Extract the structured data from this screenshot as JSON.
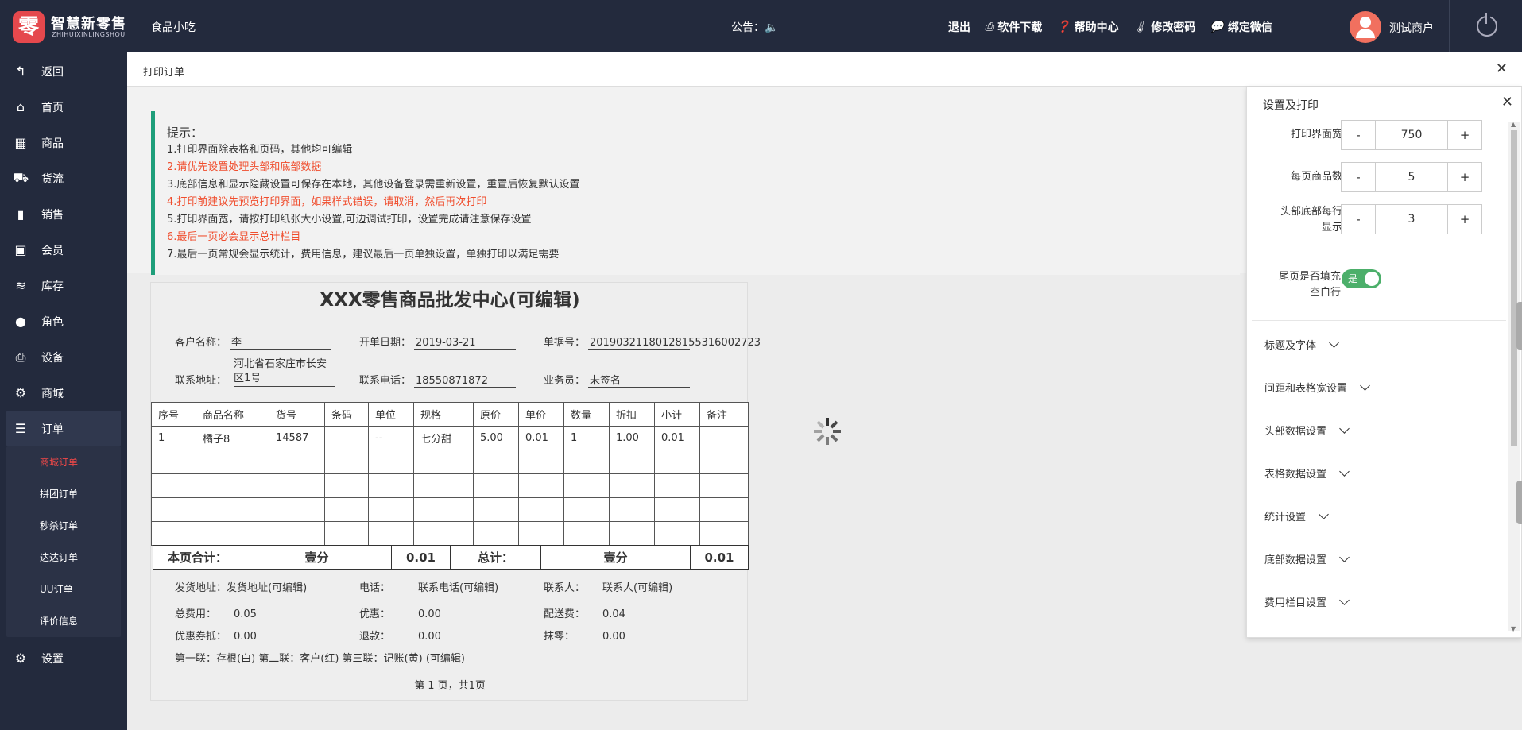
{
  "header": {
    "logo_char": "零",
    "brand": "智慧新零售",
    "brand_sub": "ZHIHUIXINLINGSHOU",
    "store": "食品小吃",
    "notice": "公告：🔈",
    "links": [
      "退出",
      "软件下载",
      "帮助中心",
      "修改密码",
      "绑定微信"
    ],
    "user": "测试商户"
  },
  "sidebar": {
    "items": [
      {
        "icon": "↰",
        "label": "返回"
      },
      {
        "icon": "⌂",
        "label": "首页"
      },
      {
        "icon": "▦",
        "label": "商品"
      },
      {
        "icon": "⛟",
        "label": "货流"
      },
      {
        "icon": "▮",
        "label": "销售"
      },
      {
        "icon": "▣",
        "label": "会员"
      },
      {
        "icon": "≋",
        "label": "库存"
      },
      {
        "icon": "●",
        "label": "角色"
      },
      {
        "icon": "⎙",
        "label": "设备"
      },
      {
        "icon": "⚙",
        "label": "商城"
      },
      {
        "icon": "☰",
        "label": "订单"
      }
    ],
    "sub": [
      "商城订单",
      "拼团订单",
      "秒杀订单",
      "达达订单",
      "UU订单",
      "评价信息"
    ],
    "settings": {
      "icon": "⚙",
      "label": "设置"
    }
  },
  "tab": {
    "title": "打印订单",
    "close": "✕"
  },
  "tips": {
    "title": "提示：",
    "lines": [
      "1.打印界面除表格和页码，其他均可编辑",
      "2.请优先设置处理头部和底部数据",
      "3.底部信息和显示隐藏设置可保存在本地，其他设备登录需重新设置，重置后恢复默认设置",
      "4.打印前建议先预览打印界面，如果样式错误，请取消，然后再次打印",
      "5.打印界面宽，请按打印纸张大小设置,可边调试打印，设置完成请注意保存设置",
      "6.最后一页必会显示总计栏目",
      "7.最后一页常规会显示统计，费用信息，建议最后一页单独设置，单独打印以满足需要"
    ]
  },
  "order": {
    "title": "XXX零售商品批发中心(可编辑)",
    "customer_label": "客户名称：",
    "customer": "李",
    "date_label": "开单日期：",
    "date": "2019-03-21",
    "no_label": "单据号：",
    "no": "20190321180128155316002723",
    "address_label": "联系地址：",
    "address_1": "河北省石家庄市长安",
    "address_2": "区1号",
    "phone_label": "联系电话：",
    "phone": "18550871872",
    "sales_label": "业务员：",
    "sales": "未签名",
    "headers": [
      "序号",
      "商品名称",
      "货号",
      "条码",
      "单位",
      "规格",
      "原价",
      "单价",
      "数量",
      "折扣",
      "小计",
      "备注"
    ],
    "rows": [
      [
        "1",
        "橘子8",
        "14587",
        "",
        "--",
        "七分甜",
        "5.00",
        "0.01",
        "1",
        "1.00",
        "0.01",
        ""
      ]
    ],
    "page_total_label": "本页合计：",
    "page_total_cn": "壹分",
    "page_total": "0.01",
    "total_label": "总计：",
    "total_cn": "壹分",
    "total": "0.01",
    "ship_label": "发货地址：",
    "ship": "发货地址(可编辑)",
    "tel_label": "电话：",
    "tel": "联系电话(可编辑)",
    "contact_label": "联系人：",
    "contact": "联系人(可编辑)",
    "fee_label": "总费用：",
    "fee": "0.05",
    "discount_label": "优惠：",
    "discount": "0.00",
    "delivery_label": "配送费：",
    "delivery": "0.04",
    "coupon_label": "优惠券抵：",
    "coupon": "0.00",
    "refund_label": "退款：",
    "refund": "0.00",
    "round_label": "抹零：",
    "round": "0.00",
    "copies": "第一联：存根(白) 第二联：客户(红) 第三联：记账(黄) (可编辑)",
    "page": "第 1 页，共1页"
  },
  "panel": {
    "title": "设置及打印",
    "width_label": "打印界面宽",
    "width": "750",
    "per_page_label": "每页商品数",
    "per_page": "5",
    "head_label": "头部底部每行显示",
    "head": "3",
    "minus": "-",
    "plus": "+",
    "fill_label": "尾页是否填充空白行",
    "toggle": "是",
    "sections": [
      "标题及字体",
      "间距和表格宽设置",
      "头部数据设置",
      "表格数据设置",
      "统计设置",
      "底部数据设置",
      "费用栏目设置"
    ]
  }
}
